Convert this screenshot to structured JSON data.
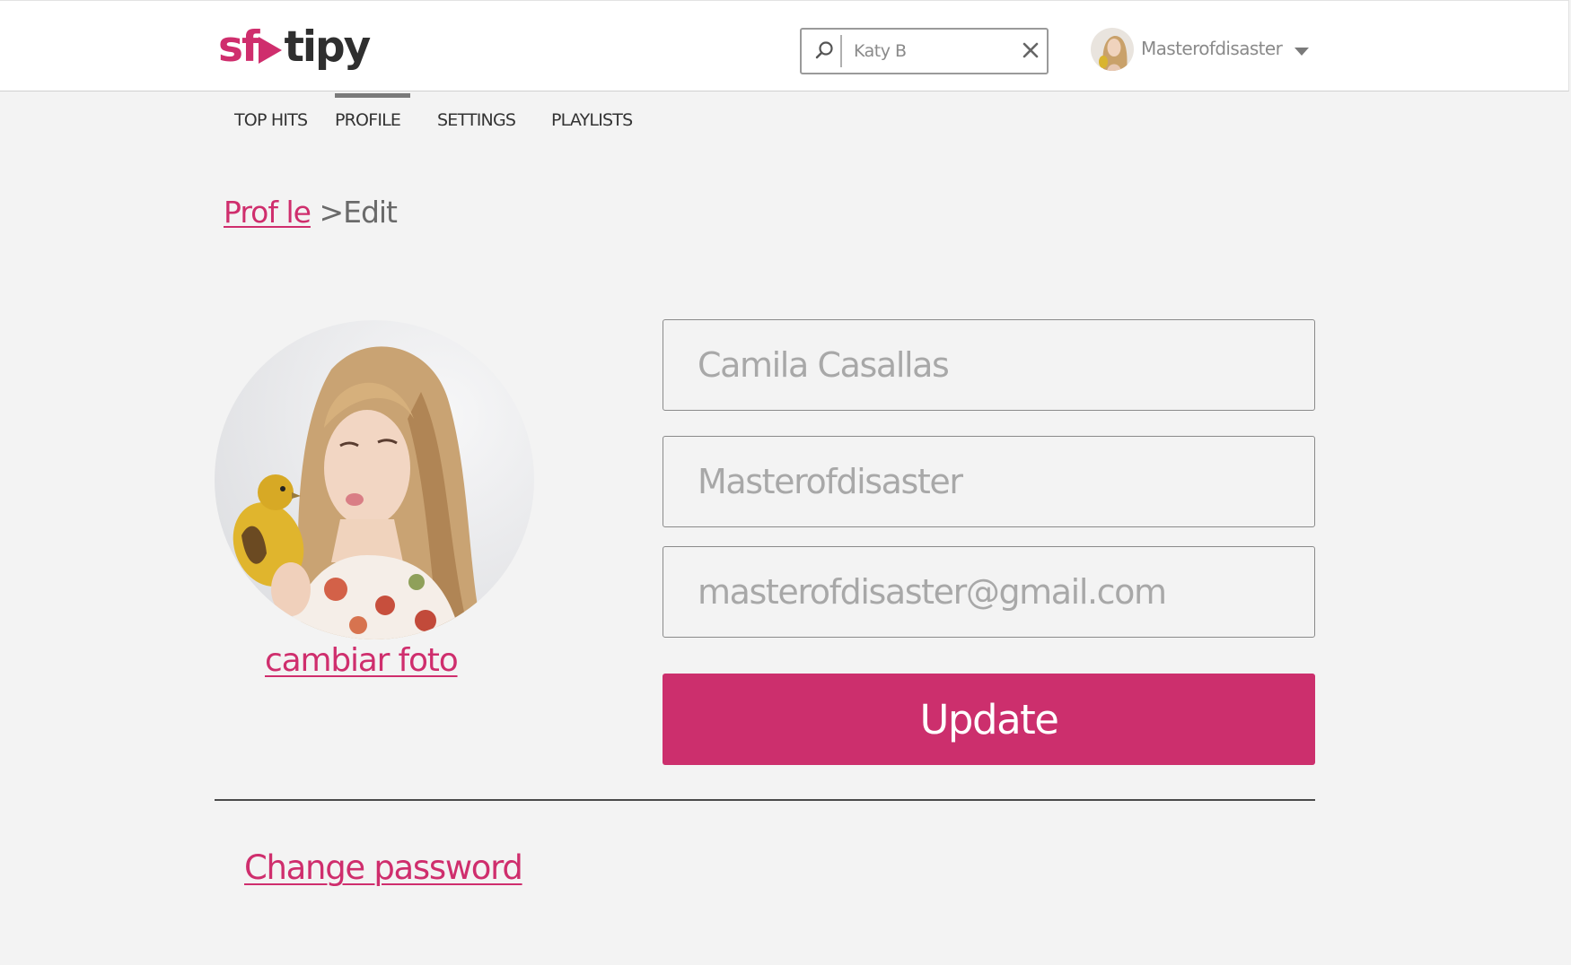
{
  "app": {
    "logo_parts": [
      "sf",
      "o",
      "tipy"
    ],
    "logo_full": "sfotipy",
    "brand_color": "#cf2e6d"
  },
  "search": {
    "value": "Katy B",
    "icon": "search-icon",
    "clear_icon": "close-icon"
  },
  "user": {
    "name": "Masterofdisaster",
    "avatar": "avatar",
    "dropdown_icon": "chevron-down-icon"
  },
  "nav": {
    "tabs": [
      {
        "label": "TOP HITS",
        "active": false
      },
      {
        "label": "PROFILE",
        "active": true
      },
      {
        "label": "SETTINGS",
        "active": false
      },
      {
        "label": "PLAYLISTS",
        "active": false
      }
    ]
  },
  "breadcrumb": {
    "parent": "Prof le",
    "separator": ">",
    "current": "Edit"
  },
  "profile": {
    "change_photo_label": "cambiar foto"
  },
  "form": {
    "full_name": "Camila Casallas",
    "username": "Masterofdisaster",
    "email": "masterofdisaster@gmail.com",
    "update_label": "Update",
    "button_color": "#cc2f6d"
  },
  "footer": {
    "change_password_label": "Change password"
  }
}
